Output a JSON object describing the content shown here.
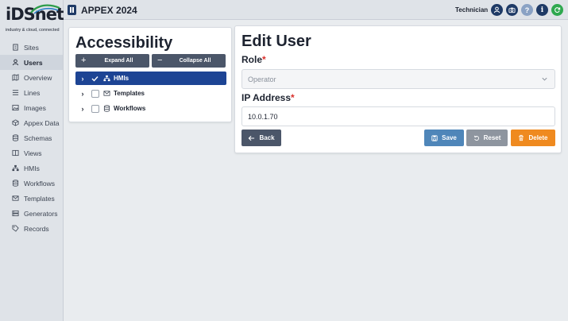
{
  "logo": {
    "word": "iDSnet",
    "tagline": "industry & cloud, connected"
  },
  "topbar": {
    "title": "APPEX 2024",
    "user_label": "Technician",
    "icons": [
      "user-icon",
      "camera-icon",
      "help-icon",
      "info-icon",
      "refresh-icon"
    ]
  },
  "sidebar": {
    "items": [
      {
        "label": "Sites",
        "icon": "building-icon"
      },
      {
        "label": "Users",
        "icon": "user-icon",
        "active": true
      },
      {
        "label": "Overview",
        "icon": "map-icon"
      },
      {
        "label": "Lines",
        "icon": "list-icon"
      },
      {
        "label": "Images",
        "icon": "image-icon"
      },
      {
        "label": "Appex Data",
        "icon": "cube-icon"
      },
      {
        "label": "Schemas",
        "icon": "database-icon"
      },
      {
        "label": "Views",
        "icon": "columns-icon"
      },
      {
        "label": "HMIs",
        "icon": "sitemap-icon"
      },
      {
        "label": "Workflows",
        "icon": "database-icon"
      },
      {
        "label": "Templates",
        "icon": "envelope-icon"
      },
      {
        "label": "Generators",
        "icon": "server-icon"
      },
      {
        "label": "Records",
        "icon": "tag-icon"
      }
    ]
  },
  "accessibility": {
    "title": "Accessibility",
    "expand_all": "Expand All",
    "collapse_all": "Collapse All",
    "tree": [
      {
        "label": "HMIs",
        "checked": true,
        "selected": true,
        "icon": "sitemap-icon"
      },
      {
        "label": "Templates",
        "checked": false,
        "icon": "envelope-icon"
      },
      {
        "label": "Workflows",
        "checked": false,
        "icon": "database-icon"
      }
    ]
  },
  "edit_user": {
    "title": "Edit User",
    "role_label": "Role",
    "role_value": "Operator",
    "ip_label": "IP Address",
    "ip_value": "10.0.1.70",
    "required_mark": "*",
    "back": "Back",
    "save": "Save",
    "reset": "Reset",
    "delete": "Delete"
  },
  "colors": {
    "primary_dark": "#1d4494",
    "save": "#4f86b9",
    "reset": "#8e959f",
    "delete": "#ef8a1f",
    "back": "#4b5669"
  }
}
